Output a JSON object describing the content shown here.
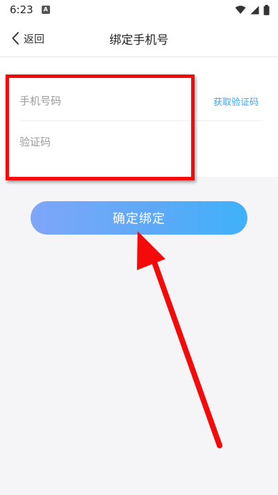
{
  "status_bar": {
    "time": "6:23",
    "app_badge": "A",
    "icons": [
      "wifi-icon",
      "signal-icon",
      "battery-icon"
    ]
  },
  "nav": {
    "back_label": "返回",
    "title": "绑定手机号"
  },
  "form": {
    "phone_placeholder": "手机号码",
    "code_placeholder": "验证码",
    "get_code_label": "获取验证码"
  },
  "confirm_label": "确定绑定",
  "colors": {
    "accent": "#3aa7f5",
    "button_gradient_start": "#7fa6f9",
    "button_gradient_end": "#3fb1fb",
    "annotation_red": "#f50a0a",
    "background": "#f5f5f7"
  }
}
